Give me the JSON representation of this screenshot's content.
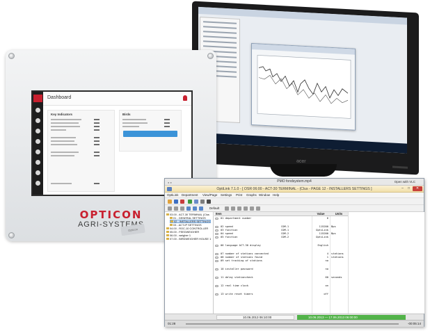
{
  "monitor": {
    "brand": "acer"
  },
  "dashboard": {
    "title": "Dashboard",
    "key_indicators_heading": "Key Indicators",
    "birds_heading": "Birds"
  },
  "branding": {
    "opticon": "OPTICON",
    "agri_systems": "AGRI-SYSTEMS",
    "sticker": "Opticon"
  },
  "viewer": {
    "title": "PMO fondsystem.mp4",
    "open_button": "Open with VLC"
  },
  "app": {
    "title": "OptiLink 7.1.0 - [ OSR 06:00 - ACT-30 TERMINAL - (Clus -  PAGE 12 - INSTALLERS SETTINGS ]",
    "window_controls": [
      "–",
      "□",
      "✕"
    ],
    "menu": [
      "OptiLink",
      "Department",
      "View/Page",
      "Settings",
      "Print",
      "Graphs",
      "Window",
      "Help"
    ],
    "toolbar_label": "Default"
  },
  "tree": {
    "items": [
      {
        "label": "03.00 - ACT-30 TERMINAL (Clus",
        "level": 0,
        "selected": false
      },
      {
        "label": "01 - GENERAL SETTINGS",
        "level": 1,
        "selected": false
      },
      {
        "label": "02 - INSTALLERS SETTINGS",
        "level": 1,
        "selected": true
      },
      {
        "label": "03 - ACT-IP SETTINGS",
        "level": 1,
        "selected": false
      },
      {
        "label": "04.00 - ROC-10 CONTROLLER",
        "level": 0,
        "selected": false
      },
      {
        "label": "05.00 - FEEDWEIGHER",
        "level": 0,
        "selected": false
      },
      {
        "label": "06.00 - weigher 1",
        "level": 0,
        "selected": false
      },
      {
        "label": "07.00 - BIRDWEIGHER HOUSE 1",
        "level": 0,
        "selected": false
      }
    ]
  },
  "grid": {
    "headers": {
      "item": "Item",
      "value": "Value",
      "unit": "Units"
    },
    "rows": [
      {
        "label": "01 department number",
        "mid": "",
        "value": "6",
        "unit": ""
      },
      {
        "label": "02 speed",
        "mid": "COM-1",
        "value": "115200",
        "unit": "Bps"
      },
      {
        "label": "03 function",
        "mid": "COM-1",
        "value": "OptiLink",
        "unit": ""
      },
      {
        "label": "04 speed",
        "mid": "COM-2",
        "value": "115200",
        "unit": "Bps"
      },
      {
        "label": "05 function",
        "mid": "COM-2",
        "value": "OptiLink",
        "unit": ""
      },
      {
        "label": "06 language ACT-30 display",
        "mid": "",
        "value": "English",
        "unit": ""
      },
      {
        "label": "07 number of stations connected",
        "mid": "",
        "value": "4",
        "unit": "stations"
      },
      {
        "label": "08 number of stations found",
        "mid": "",
        "value": "1",
        "unit": "stations"
      },
      {
        "label": "09 set tracking of stations",
        "mid": "",
        "value": "no",
        "unit": ""
      },
      {
        "label": "10 installer password",
        "mid": "",
        "value": "no",
        "unit": ""
      },
      {
        "label": "11 delay stationcheck",
        "mid": "",
        "value": "60",
        "unit": "seconds"
      },
      {
        "label": "12 real time clock",
        "mid": "",
        "value": "on",
        "unit": ""
      },
      {
        "label": "13 write reset timers",
        "mid": "",
        "value": "off",
        "unit": ""
      }
    ]
  },
  "status": {
    "date": "10.06.2013 06:10:00",
    "range": "10.06.2013 — 17.06.2013 06:00:00"
  },
  "player": {
    "elapsed": "01:28",
    "remaining": "-00:05:14"
  }
}
